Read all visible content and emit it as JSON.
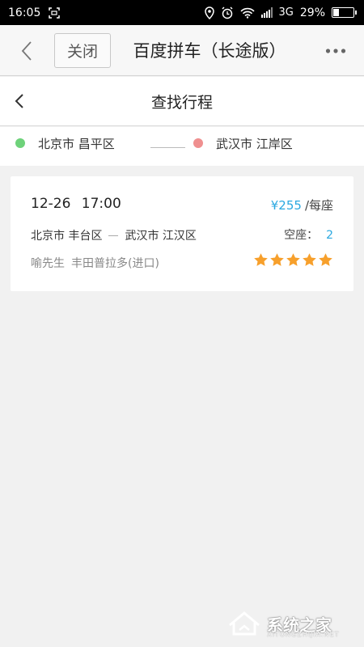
{
  "status_bar": {
    "time": "16:05",
    "network": "3G",
    "battery": "29%",
    "battery_level": 0.29
  },
  "browser": {
    "close_label": "关闭",
    "title": "百度拼车（长途版）"
  },
  "page": {
    "title": "查找行程"
  },
  "route": {
    "from": "北京市 昌平区",
    "to": "武汉市 江岸区",
    "from_color": "#6ed27a",
    "to_color": "#ef8f8f"
  },
  "trips": [
    {
      "datetime": "12-26  17:00",
      "price": "¥255",
      "price_unit": "/每座",
      "from": "北京市  丰台区",
      "to": "武汉市  江汉区",
      "seats_label": "空座：",
      "seats": "2",
      "driver": "喻先生",
      "car": "丰田普拉多(进口)",
      "rating": 5,
      "rating_max": 5
    }
  ],
  "watermark": {
    "text": "系统之家",
    "sub": "XITONGZHIJIA.NET"
  },
  "colors": {
    "accent": "#2aa8e0",
    "star": "#f7a02c"
  }
}
